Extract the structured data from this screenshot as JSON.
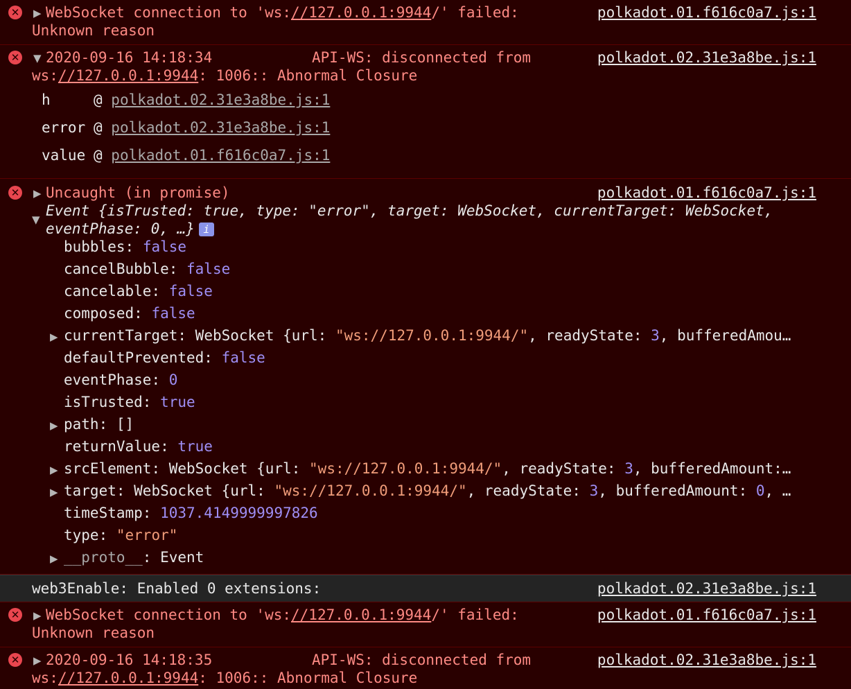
{
  "colors": {
    "error_bg": "#290000",
    "error_text": "#fe8a84",
    "keyword": "#9f8ff6",
    "string": "#f19d7a"
  },
  "entries": [
    {
      "prefix": "WebSocket connection to 'ws:",
      "url": "//127.0.0.1:9944",
      "suffix": "/' failed:",
      "line2": "Unknown reason",
      "source": "polkadot.01.f616c0a7.js:1"
    },
    {
      "timestamp": "2020-09-16 14:18:34",
      "message": "API-WS: disconnected from",
      "line2_prefix": "ws:",
      "line2_url": "//127.0.0.1:9944",
      "line2_suffix": ": 1006:: Abnormal Closure",
      "source": "polkadot.02.31e3a8be.js:1",
      "stack": [
        {
          "name": "h",
          "link": "polkadot.02.31e3a8be.js:1"
        },
        {
          "name": "error",
          "link": "polkadot.02.31e3a8be.js:1"
        },
        {
          "name": "value",
          "link": "polkadot.01.f616c0a7.js:1"
        }
      ]
    },
    {
      "message": "Uncaught (in promise)",
      "source": "polkadot.01.f616c0a7.js:1",
      "summary_line1": "Event {isTrusted: true, type: \"error\", target: WebSocket, currentTarget: WebSocket,",
      "summary_line2": "eventPhase: 0, …}",
      "props": [
        "bubbles: false",
        "cancelBubble: false",
        "cancelable: false",
        "composed: false",
        "currentTarget: WebSocket {url: \"ws://127.0.0.1:9944/\", readyState: 3, bufferedAmou…",
        "defaultPrevented: false",
        "eventPhase: 0",
        "isTrusted: true",
        "path: []",
        "returnValue: true",
        "srcElement: WebSocket {url: \"ws://127.0.0.1:9944/\", readyState: 3, bufferedAmount:…",
        "target: WebSocket {url: \"ws://127.0.0.1:9944/\", readyState: 3, bufferedAmount: 0, …",
        "timeStamp: 1037.4149999997826",
        "type: \"error\"",
        "__proto__: Event"
      ]
    },
    {
      "message": "web3Enable: Enabled 0 extensions:",
      "source": "polkadot.02.31e3a8be.js:1"
    },
    {
      "prefix": "WebSocket connection to 'ws:",
      "url": "//127.0.0.1:9944",
      "suffix": "/' failed:",
      "line2": "Unknown reason",
      "source": "polkadot.01.f616c0a7.js:1"
    },
    {
      "timestamp": "2020-09-16 14:18:35",
      "message": "API-WS: disconnected from",
      "line2_prefix": "ws:",
      "line2_url": "//127.0.0.1:9944",
      "line2_suffix": ": 1006:: Abnormal Closure",
      "source": "polkadot.02.31e3a8be.js:1"
    }
  ]
}
